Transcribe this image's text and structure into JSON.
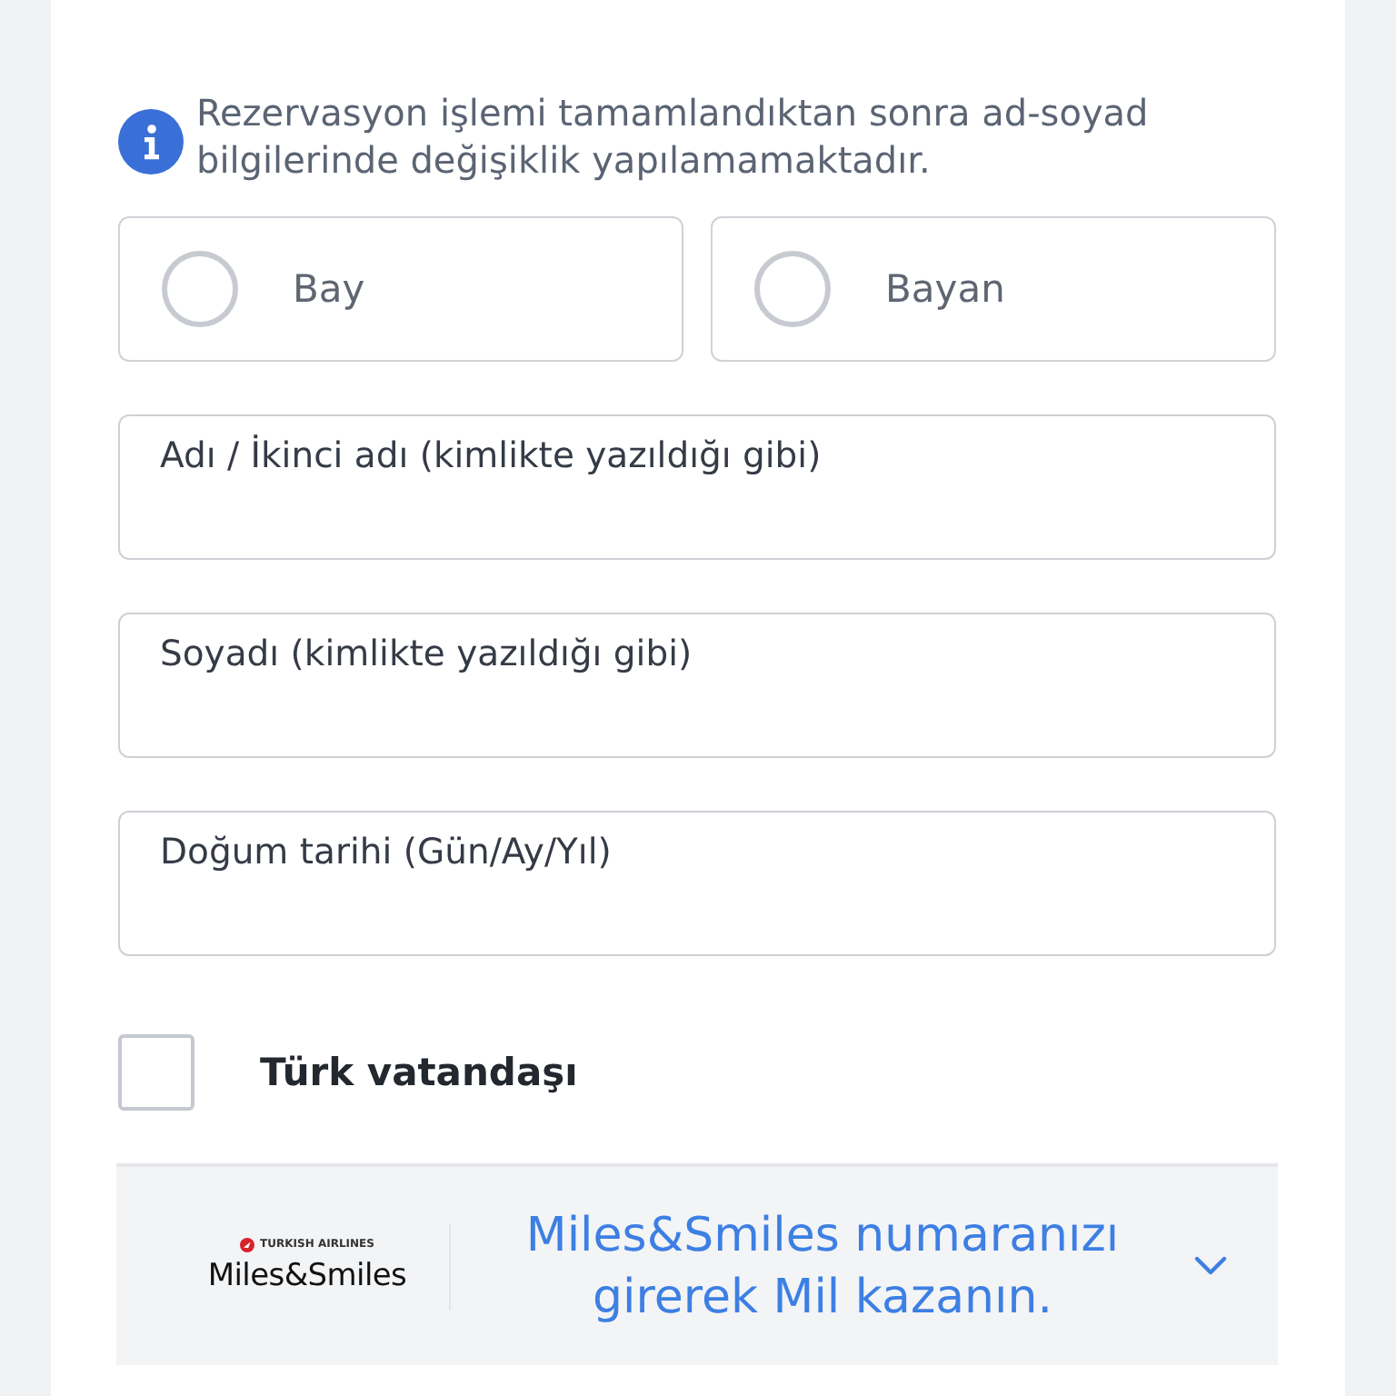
{
  "notice": {
    "text": "Rezervasyon işlemi tamamlandıktan sonra ad-soyad bilgilerinde değişiklik yapılamamaktadır."
  },
  "gender_options": [
    {
      "label": "Bay",
      "selected": false
    },
    {
      "label": "Bayan",
      "selected": false
    }
  ],
  "fields": [
    {
      "placeholder": "Adı / İkinci adı (kimlikte yazıldığı gibi)"
    },
    {
      "placeholder": "Soyadı (kimlikte yazıldığı gibi)"
    },
    {
      "placeholder": "Doğum tarihi (Gün/Ay/Yıl)"
    }
  ],
  "citizenship": {
    "label": "Türk vatandaşı",
    "checked": false
  },
  "loyalty": {
    "logo_caption": "TURKISH AIRLINES",
    "logo_name": "Miles&Smiles",
    "prompt": "Miles&Smiles numaranızı girerek Mil kazanın.",
    "expanded": false
  }
}
